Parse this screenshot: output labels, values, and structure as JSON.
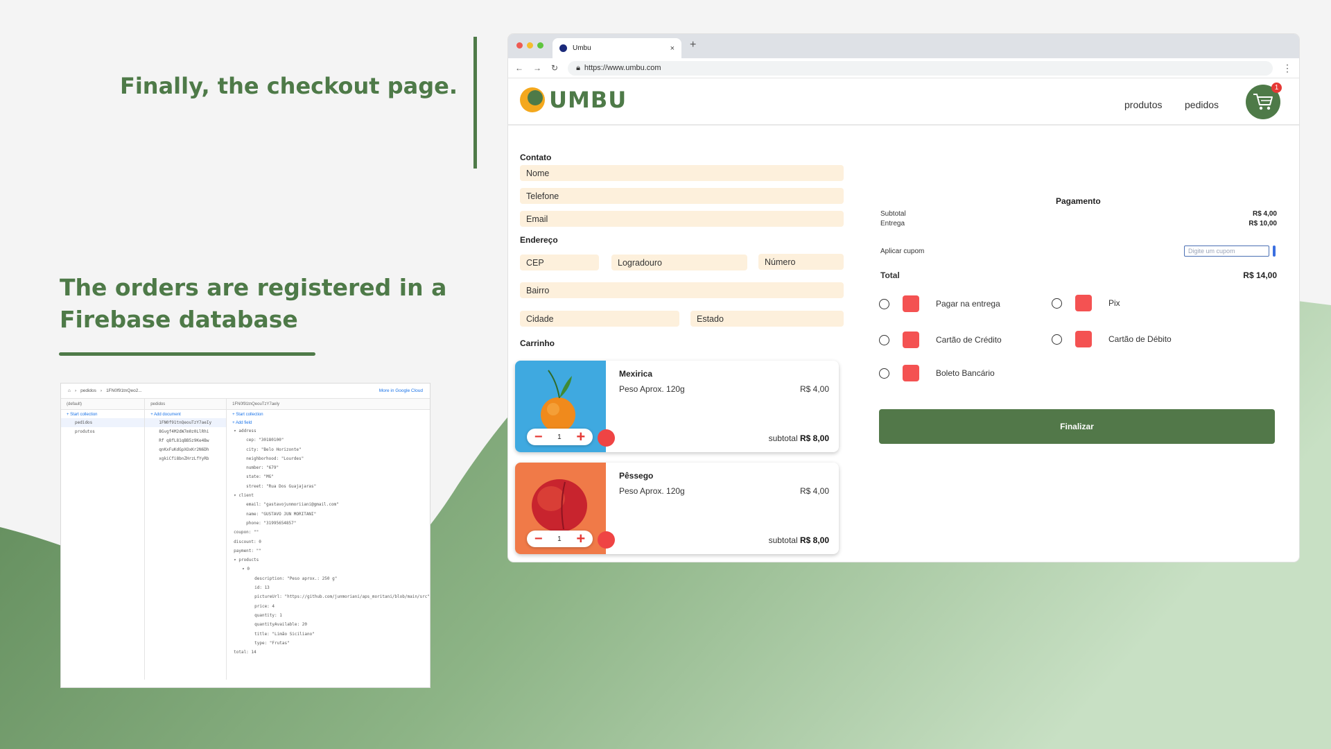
{
  "slide": {
    "heading_top": "Finally, the checkout page.",
    "heading_bottom": "The orders are registered in a Firebase database",
    "colors": {
      "accent": "#4e7a48",
      "background": "#f4f4f4"
    }
  },
  "firebase": {
    "breadcrumb": [
      "pedidos",
      "1FN0f91tnQeo2..."
    ],
    "cloud_link": "More in Google Cloud",
    "col1": {
      "header": "(default)",
      "add": "+ Start collection",
      "items": [
        "pedidos",
        "produtos"
      ]
    },
    "col2": {
      "header": "pedidos",
      "add": "+ Add document",
      "items": [
        "1FN0f91tnQeouTzY7aeIy",
        "8Gvgf4M2dW7m0z0LlRhi",
        "Rf q8fL81qBB5z9Ke4Bw",
        "qnKxFuKdGpXOxKr2N6Dh",
        "xgkiCfi8bnZHrzLfYyRb"
      ]
    },
    "col3": {
      "header": "1FN0f91tnQeouTzY7aeIy",
      "add_collection": "+ Start collection",
      "add_field": "+ Add field",
      "fields": [
        "▾ address",
        "cep: \"30180100\"",
        "city: \"Belo Horizonte\"",
        "neighborhood: \"Lourdes\"",
        "number: \"679\"",
        "state: \"MG\"",
        "street: \"Rua Dos Guajajaras\"",
        "▾ client",
        "email: \"gastavojunmoriiani@gmail.com\"",
        "name: \"GUSTAVO JUN MORITANI\"",
        "phone: \"31995654857\"",
        "coupon: \"\"",
        "discount: 0",
        "payment: \"\"",
        "▾ products",
        "▾ 0",
        "description: \"Peso aprox.: 250 g\"",
        "id: 13",
        "pictureUrl: \"https://github.com/junmoriani/aps_moritani/blob/main/src\"",
        "price: 4",
        "quantity: 1",
        "quantityAvailable: 20",
        "title: \"Limão Siciliano\"",
        "type: \"Frutas\"",
        "total: 14"
      ]
    }
  },
  "browser": {
    "tab_title": "Umbu",
    "new_tab": "+",
    "close_tab": "×",
    "url": "https://www.umbu.com",
    "nav": {
      "back": "←",
      "forward": "→",
      "reload": "↻",
      "menu": "⋮"
    }
  },
  "site": {
    "logo_text": "UMBU",
    "nav_products": "produtos",
    "nav_orders": "pedidos",
    "cart_count": "1",
    "contact_label": "Contato",
    "contact_fields": [
      "Nome",
      "Telefone",
      "Email"
    ],
    "address_label": "Endereço",
    "address_fields": {
      "cep": "CEP",
      "street": "Logradouro",
      "number": "Número",
      "district": "Bairro",
      "city": "Cidade",
      "state": "Estado"
    },
    "cart_label": "Carrinho",
    "cart_items": [
      {
        "title": "Mexirica",
        "desc": "Peso Aprox. 120g",
        "price": "R$ 4,00",
        "qty": "1",
        "subtotal_label": "subtotal",
        "subtotal": "R$ 8,00"
      },
      {
        "title": "Pêssego",
        "desc": "Peso Aprox. 120g",
        "price": "R$ 4,00",
        "qty": "1",
        "subtotal_label": "subtotal",
        "subtotal": "R$ 8,00"
      }
    ],
    "payment": {
      "title": "Pagamento",
      "subtotal_label": "Subtotal",
      "subtotal": "R$ 4,00",
      "delivery_label": "Entrega",
      "delivery": "R$ 10,00",
      "coupon_label": "Aplicar cupom",
      "coupon_placeholder": "Digite um cupom",
      "total_label": "Total",
      "total": "R$ 14,00",
      "options": [
        "Pagar na entrega",
        "Pix",
        "Cartão de Crédito",
        "Cartão de Débito",
        "Boleto Bancário"
      ],
      "submit": "Finalizar"
    },
    "colors": {
      "field_bg": "#fdf0dc",
      "button": "#527849",
      "pay_icon": "#f45252",
      "badge": "#e53935"
    }
  }
}
